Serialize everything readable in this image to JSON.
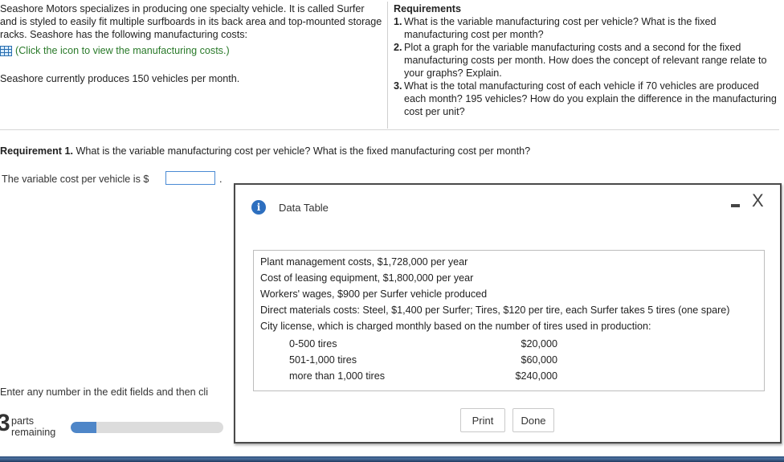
{
  "problem": {
    "intro": "Seashore Motors specializes in producing one specialty vehicle. It is called Surfer and is styled to easily fit multiple surfboards in its back area and top-mounted storage racks. Seashore has the following manufacturing costs:",
    "click_text": "(Click the icon to view the manufacturing costs.)",
    "current_production": "Seashore currently produces 150 vehicles per month."
  },
  "requirements": {
    "title": "Requirements",
    "items": [
      {
        "num": "1.",
        "text": "What is the variable manufacturing cost per vehicle? What is the fixed manufacturing cost per month?"
      },
      {
        "num": "2.",
        "text": "Plot a graph for the variable manufacturing costs and a second for the fixed manufacturing costs per month. How does the concept of relevant range relate to your graphs? Explain."
      },
      {
        "num": "3.",
        "text": "What is the total manufacturing cost of each vehicle if 70 vehicles are produced each month? 195 vehicles? How do you explain the difference in the manufacturing cost per unit?"
      }
    ]
  },
  "requirement1": {
    "label": "Requirement 1.",
    "text": "What is the variable manufacturing cost per vehicle? What is the fixed manufacturing cost per month?"
  },
  "variable_cost": {
    "label": "The variable cost per vehicle is $",
    "value": "",
    "trailing": "."
  },
  "footer": {
    "instruction": "Enter any number in the edit fields and then cli",
    "parts_count": "3",
    "parts_line1": "parts",
    "parts_line2": "remaining",
    "progress_fraction": 0.17
  },
  "modal": {
    "title": "Data Table",
    "info_glyph": "i",
    "close_glyph": "X",
    "rows": [
      "Plant management costs, $1,728,000 per year",
      "Cost of leasing equipment, $1,800,000 per year",
      "Workers' wages, $900 per Surfer vehicle produced",
      "Direct materials costs: Steel, $1,400 per Surfer; Tires, $120 per tire, each Surfer takes 5 tires (one spare)",
      "City license, which is charged monthly based on the number of tires used in production:"
    ],
    "license_tiers": [
      {
        "range": "0-500 tires",
        "amount": "$20,000"
      },
      {
        "range": "501-1,000 tires",
        "amount": "$60,000"
      },
      {
        "range": "more than 1,000 tires",
        "amount": "$240,000"
      }
    ],
    "print_label": "Print",
    "done_label": "Done"
  },
  "colors": {
    "accent": "#2d6fbf",
    "progress": "#4e86c8",
    "link_green": "#2a7a2a"
  }
}
